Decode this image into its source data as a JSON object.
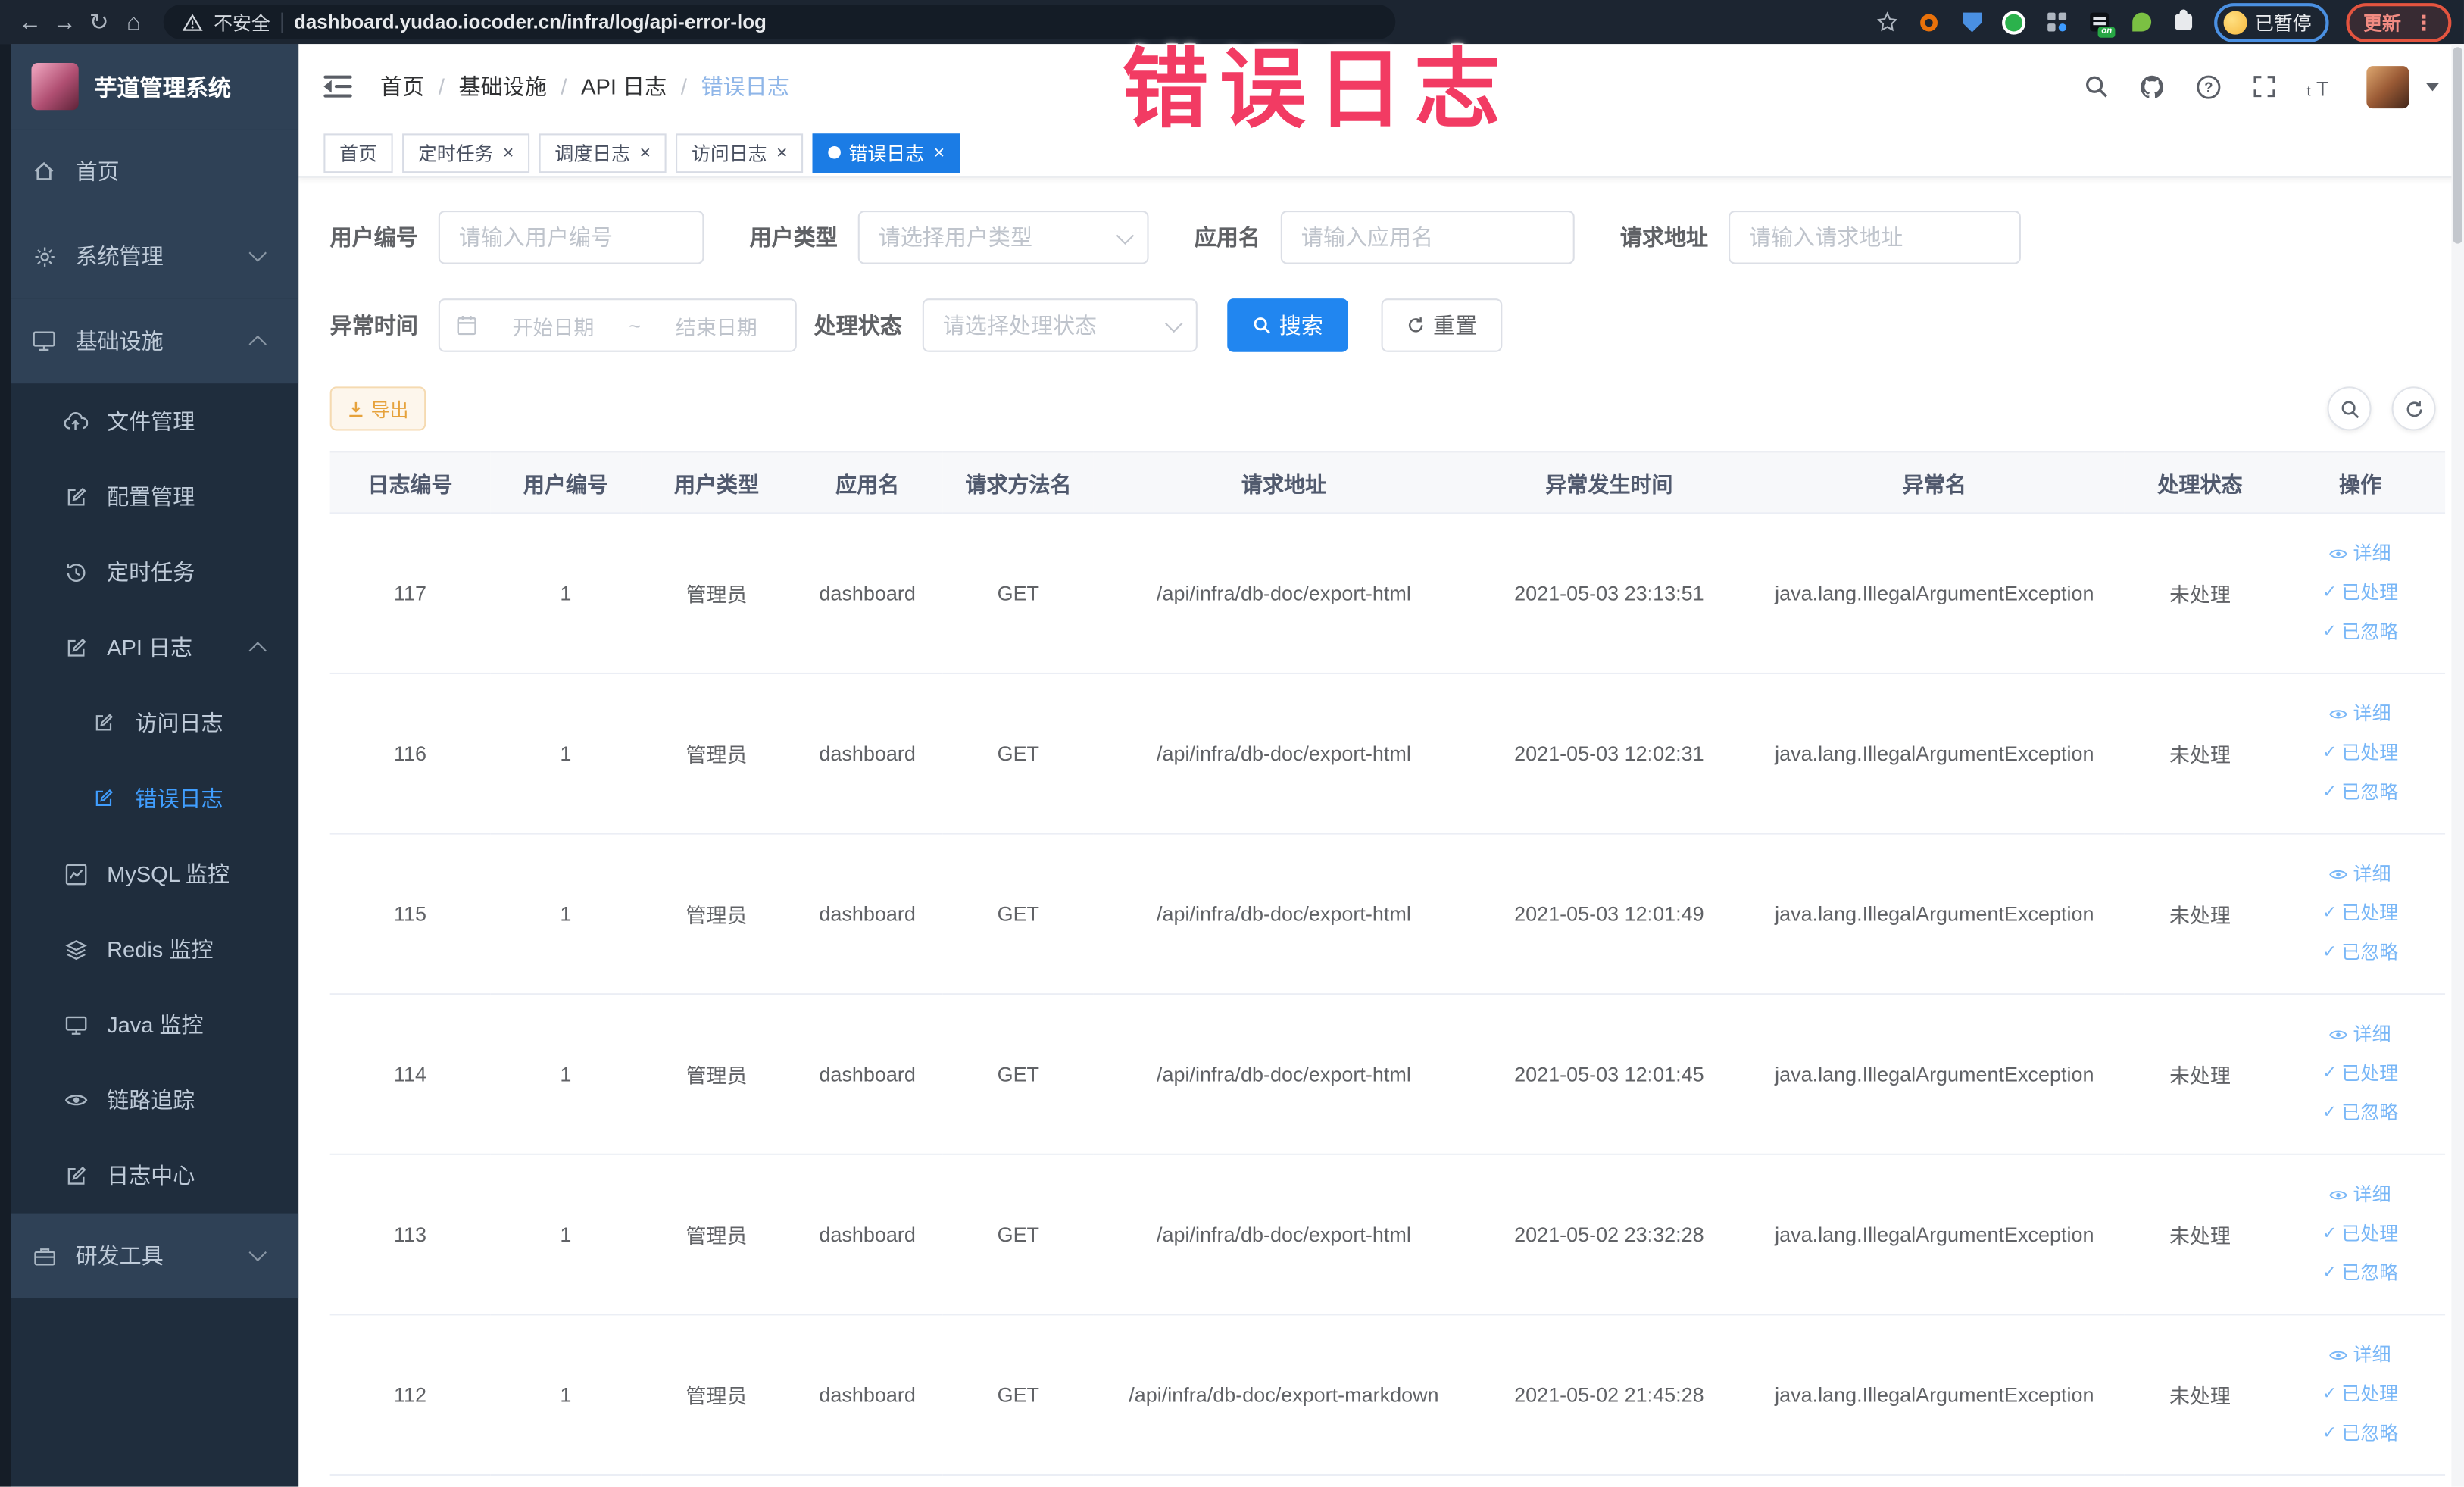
{
  "browser": {
    "security_label": "不安全",
    "url": "dashboard.yudao.iocoder.cn/infra/log/api-error-log",
    "paused_label": "已暂停",
    "update_label": "更新"
  },
  "watermark_text": "错误日志",
  "sidebar": {
    "logo_title": "芋道管理系统",
    "items": [
      "首页",
      "系统管理",
      "基础设施",
      "文件管理",
      "配置管理",
      "定时任务",
      "API 日志",
      "访问日志",
      "错误日志",
      "MySQL 监控",
      "Redis 监控",
      "Java 监控",
      "链路追踪",
      "日志中心",
      "研发工具"
    ]
  },
  "header": {
    "breadcrumb": [
      "首页",
      "基础设施",
      "API 日志",
      "错误日志"
    ]
  },
  "tabs": [
    "首页",
    "定时任务",
    "调度日志",
    "访问日志",
    "错误日志"
  ],
  "filters": {
    "user_id": {
      "label": "用户编号",
      "placeholder": "请输入用户编号"
    },
    "user_type": {
      "label": "用户类型",
      "placeholder": "请选择用户类型"
    },
    "app_name": {
      "label": "应用名",
      "placeholder": "请输入应用名"
    },
    "request_url": {
      "label": "请求地址",
      "placeholder": "请输入请求地址"
    },
    "exception_time": {
      "label": "异常时间",
      "start_placeholder": "开始日期",
      "separator": "~",
      "end_placeholder": "结束日期"
    },
    "process_status": {
      "label": "处理状态",
      "placeholder": "请选择处理状态"
    },
    "search_label": "搜索",
    "reset_label": "重置"
  },
  "toolbar": {
    "export_label": "导出"
  },
  "table": {
    "headers": [
      "日志编号",
      "用户编号",
      "用户类型",
      "应用名",
      "请求方法名",
      "请求地址",
      "异常发生时间",
      "异常名",
      "处理状态",
      "操作"
    ],
    "row_actions": [
      "详细",
      "已处理",
      "已忽略"
    ],
    "rows": [
      [
        "117",
        "1",
        "管理员",
        "dashboard",
        "GET",
        "/api/infra/db-doc/export-html",
        "2021-05-03 23:13:51",
        "java.lang.IllegalArgumentException",
        "未处理"
      ],
      [
        "116",
        "1",
        "管理员",
        "dashboard",
        "GET",
        "/api/infra/db-doc/export-html",
        "2021-05-03 12:02:31",
        "java.lang.IllegalArgumentException",
        "未处理"
      ],
      [
        "115",
        "1",
        "管理员",
        "dashboard",
        "GET",
        "/api/infra/db-doc/export-html",
        "2021-05-03 12:01:49",
        "java.lang.IllegalArgumentException",
        "未处理"
      ],
      [
        "114",
        "1",
        "管理员",
        "dashboard",
        "GET",
        "/api/infra/db-doc/export-html",
        "2021-05-03 12:01:45",
        "java.lang.IllegalArgumentException",
        "未处理"
      ],
      [
        "113",
        "1",
        "管理员",
        "dashboard",
        "GET",
        "/api/infra/db-doc/export-html",
        "2021-05-02 23:32:28",
        "java.lang.IllegalArgumentException",
        "未处理"
      ],
      [
        "112",
        "1",
        "管理员",
        "dashboard",
        "GET",
        "/api/infra/db-doc/export-markdown",
        "2021-05-02 21:45:28",
        "java.lang.IllegalArgumentException",
        "未处理"
      ]
    ]
  },
  "colors": {
    "accent_button": "#2186f0",
    "active_tab": "#1b7ce5",
    "active_menu_text": "#409eff",
    "watermark": "#f23b63",
    "export_text": "#e6a23c",
    "sidebar_bg": "#1f2d3d",
    "sidebar_root_bg": "#2f4156",
    "action_link": "#79b7f7"
  }
}
